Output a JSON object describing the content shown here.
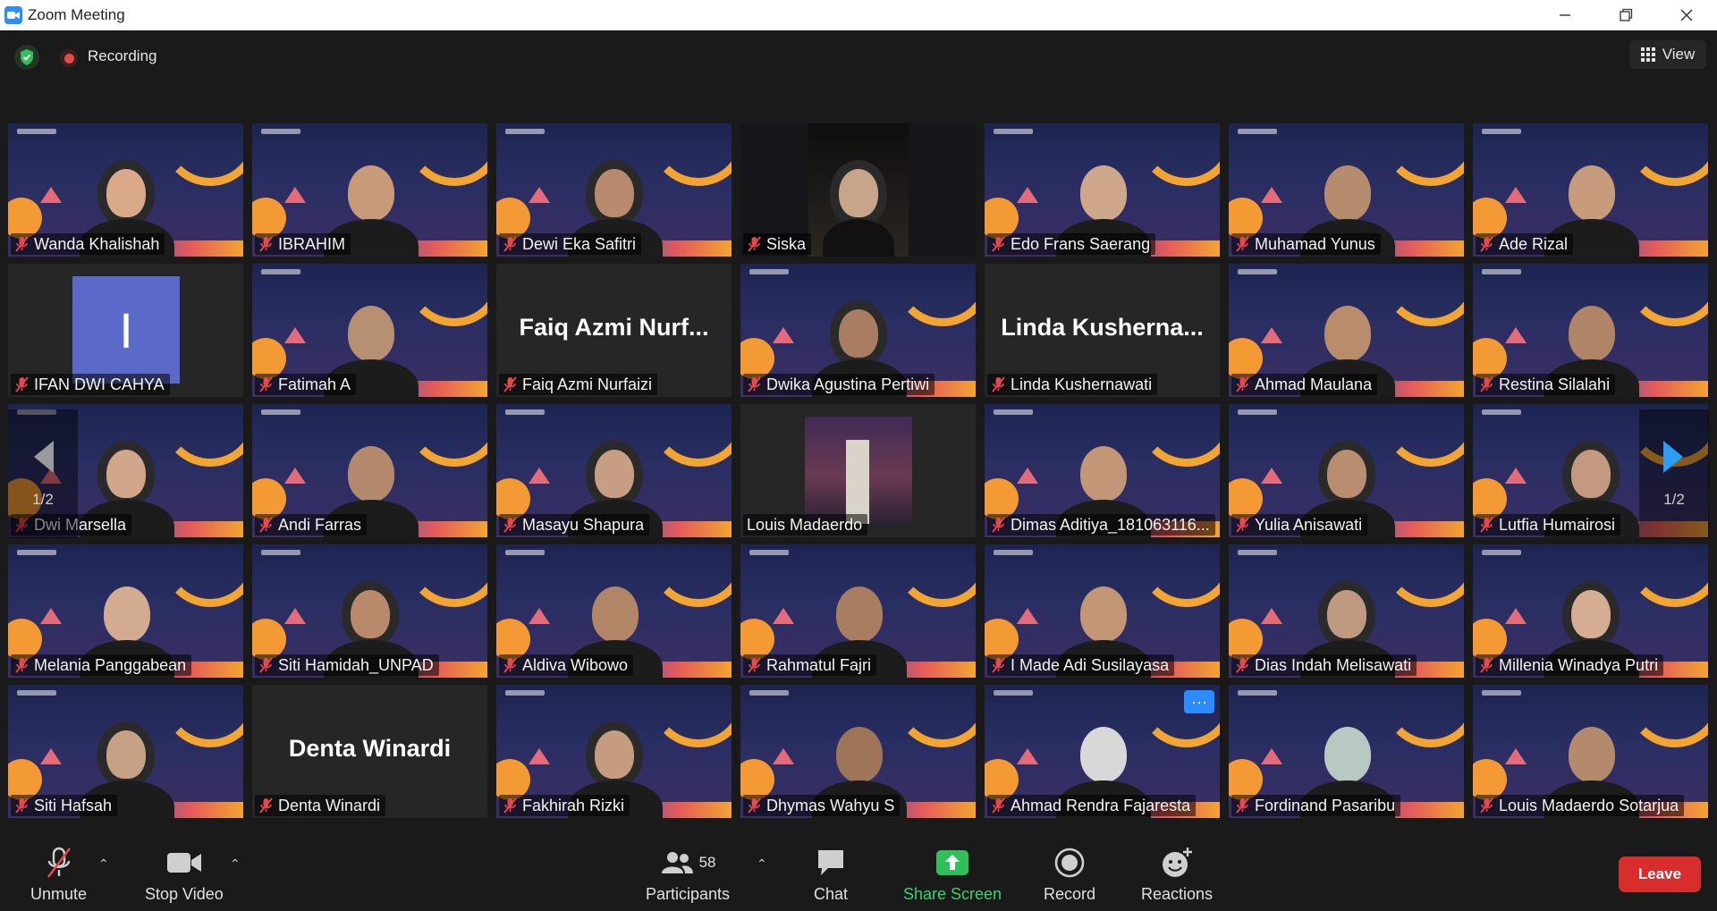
{
  "window": {
    "title": "Zoom Meeting"
  },
  "topbar": {
    "recording_label": "Recording",
    "view_label": "View"
  },
  "participants": [
    {
      "name": "Wanda Khalishah",
      "kind": "vb",
      "hijab": true,
      "skin": "#d9a98a"
    },
    {
      "name": "IBRAHIM",
      "kind": "vb",
      "hijab": false,
      "skin": "#c99a7a"
    },
    {
      "name": "Dewi Eka Safitri",
      "kind": "vb",
      "hijab": true,
      "skin": "#b98a6e"
    },
    {
      "name": "Siska",
      "kind": "cam",
      "hijab": true,
      "skin": "#c8a48a"
    },
    {
      "name": "Edo Frans Saerang",
      "kind": "vb",
      "hijab": false,
      "skin": "#cfa88c"
    },
    {
      "name": "Muhamad Yunus",
      "kind": "vb",
      "hijab": false,
      "skin": "#b58c6e"
    },
    {
      "name": "Ade Rizal",
      "kind": "vb",
      "hijab": false,
      "skin": "#c79b7c"
    },
    {
      "name": "IFAN DWI CAHYA",
      "kind": "initial",
      "initial": "I"
    },
    {
      "name": "Fatimah A",
      "kind": "vb",
      "hijab": false,
      "skin": "#b78f72"
    },
    {
      "name": "Faiq Azmi Nurfaizi",
      "kind": "text",
      "big": "Faiq Azmi Nurf..."
    },
    {
      "name": "Dwika Agustina Pertiwi",
      "kind": "vb",
      "hijab": true,
      "skin": "#a87d62"
    },
    {
      "name": "Linda Kushernawati",
      "kind": "text",
      "big": "Linda Kusherna..."
    },
    {
      "name": "Ahmad Maulana",
      "kind": "vb",
      "hijab": false,
      "skin": "#b98c6c"
    },
    {
      "name": "Restina Silalahi",
      "kind": "vb",
      "hijab": false,
      "skin": "#b08467"
    },
    {
      "name": "Dwi Marsella",
      "kind": "vb",
      "hijab": true,
      "skin": "#d2a68a"
    },
    {
      "name": "Andi Farras",
      "kind": "vb",
      "hijab": false,
      "skin": "#b38a6e"
    },
    {
      "name": "Masayu Shapura",
      "kind": "vb",
      "hijab": true,
      "skin": "#c79e84"
    },
    {
      "name": "Louis Madaerdo",
      "kind": "photo"
    },
    {
      "name": "Dimas Aditiya_181063116...",
      "kind": "vb",
      "hijab": false,
      "skin": "#c29676"
    },
    {
      "name": "Yulia Anisawati",
      "kind": "vb",
      "hijab": true,
      "skin": "#b88d70"
    },
    {
      "name": "Lutfia Humairosi",
      "kind": "vb",
      "hijab": true,
      "skin": "#c39a80"
    },
    {
      "name": "Melania Panggabean",
      "kind": "vb",
      "hijab": false,
      "skin": "#d3ab90"
    },
    {
      "name": "Siti Hamidah_UNPAD",
      "kind": "vb",
      "hijab": true,
      "skin": "#b8896a"
    },
    {
      "name": "Aldiva Wibowo",
      "kind": "vb",
      "hijab": false,
      "skin": "#b28566"
    },
    {
      "name": "Rahmatul Fajri",
      "kind": "vb",
      "hijab": false,
      "skin": "#a97d60"
    },
    {
      "name": "I Made Adi Susilayasa",
      "kind": "vb",
      "hijab": false,
      "skin": "#c29574"
    },
    {
      "name": "Dias Indah Melisawati",
      "kind": "vb",
      "hijab": true,
      "skin": "#c09a80"
    },
    {
      "name": "Millenia Winadya Putri",
      "kind": "vb",
      "hijab": true,
      "skin": "#d4ad92"
    },
    {
      "name": "Siti Hafsah",
      "kind": "vb",
      "hijab": true,
      "skin": "#c7a186"
    },
    {
      "name": "Denta Winardi",
      "kind": "text",
      "big": "Denta Winardi"
    },
    {
      "name": "Fakhirah Rizki",
      "kind": "vb",
      "hijab": true,
      "skin": "#c59c80"
    },
    {
      "name": "Dhymas Wahyu S",
      "kind": "vb",
      "hijab": false,
      "skin": "#9e7558"
    },
    {
      "name": "Ahmad Rendra Fajaresta",
      "kind": "vb",
      "hijab": false,
      "skin": "#d8d8d8",
      "menu": "···"
    },
    {
      "name": "Fordinand Pasaribu",
      "kind": "vb",
      "hijab": false,
      "skin": "#b8c8c2"
    },
    {
      "name": "Louis Madaerdo Sotarjua",
      "kind": "vb",
      "hijab": false,
      "skin": "#b38a6c"
    }
  ],
  "pagination": {
    "left_page": "1/2",
    "right_page": "1/2"
  },
  "toolbar": {
    "unmute_label": "Unmute",
    "stop_video_label": "Stop Video",
    "participants_label": "Participants",
    "participants_count": "58",
    "chat_label": "Chat",
    "share_label": "Share Screen",
    "record_label": "Record",
    "reactions_label": "Reactions",
    "leave_label": "Leave"
  },
  "colors": {
    "accent": "#2d8cff",
    "share_green": "#3ad16e",
    "leave_red": "#d92d2d",
    "muted_red": "#e5484d"
  }
}
